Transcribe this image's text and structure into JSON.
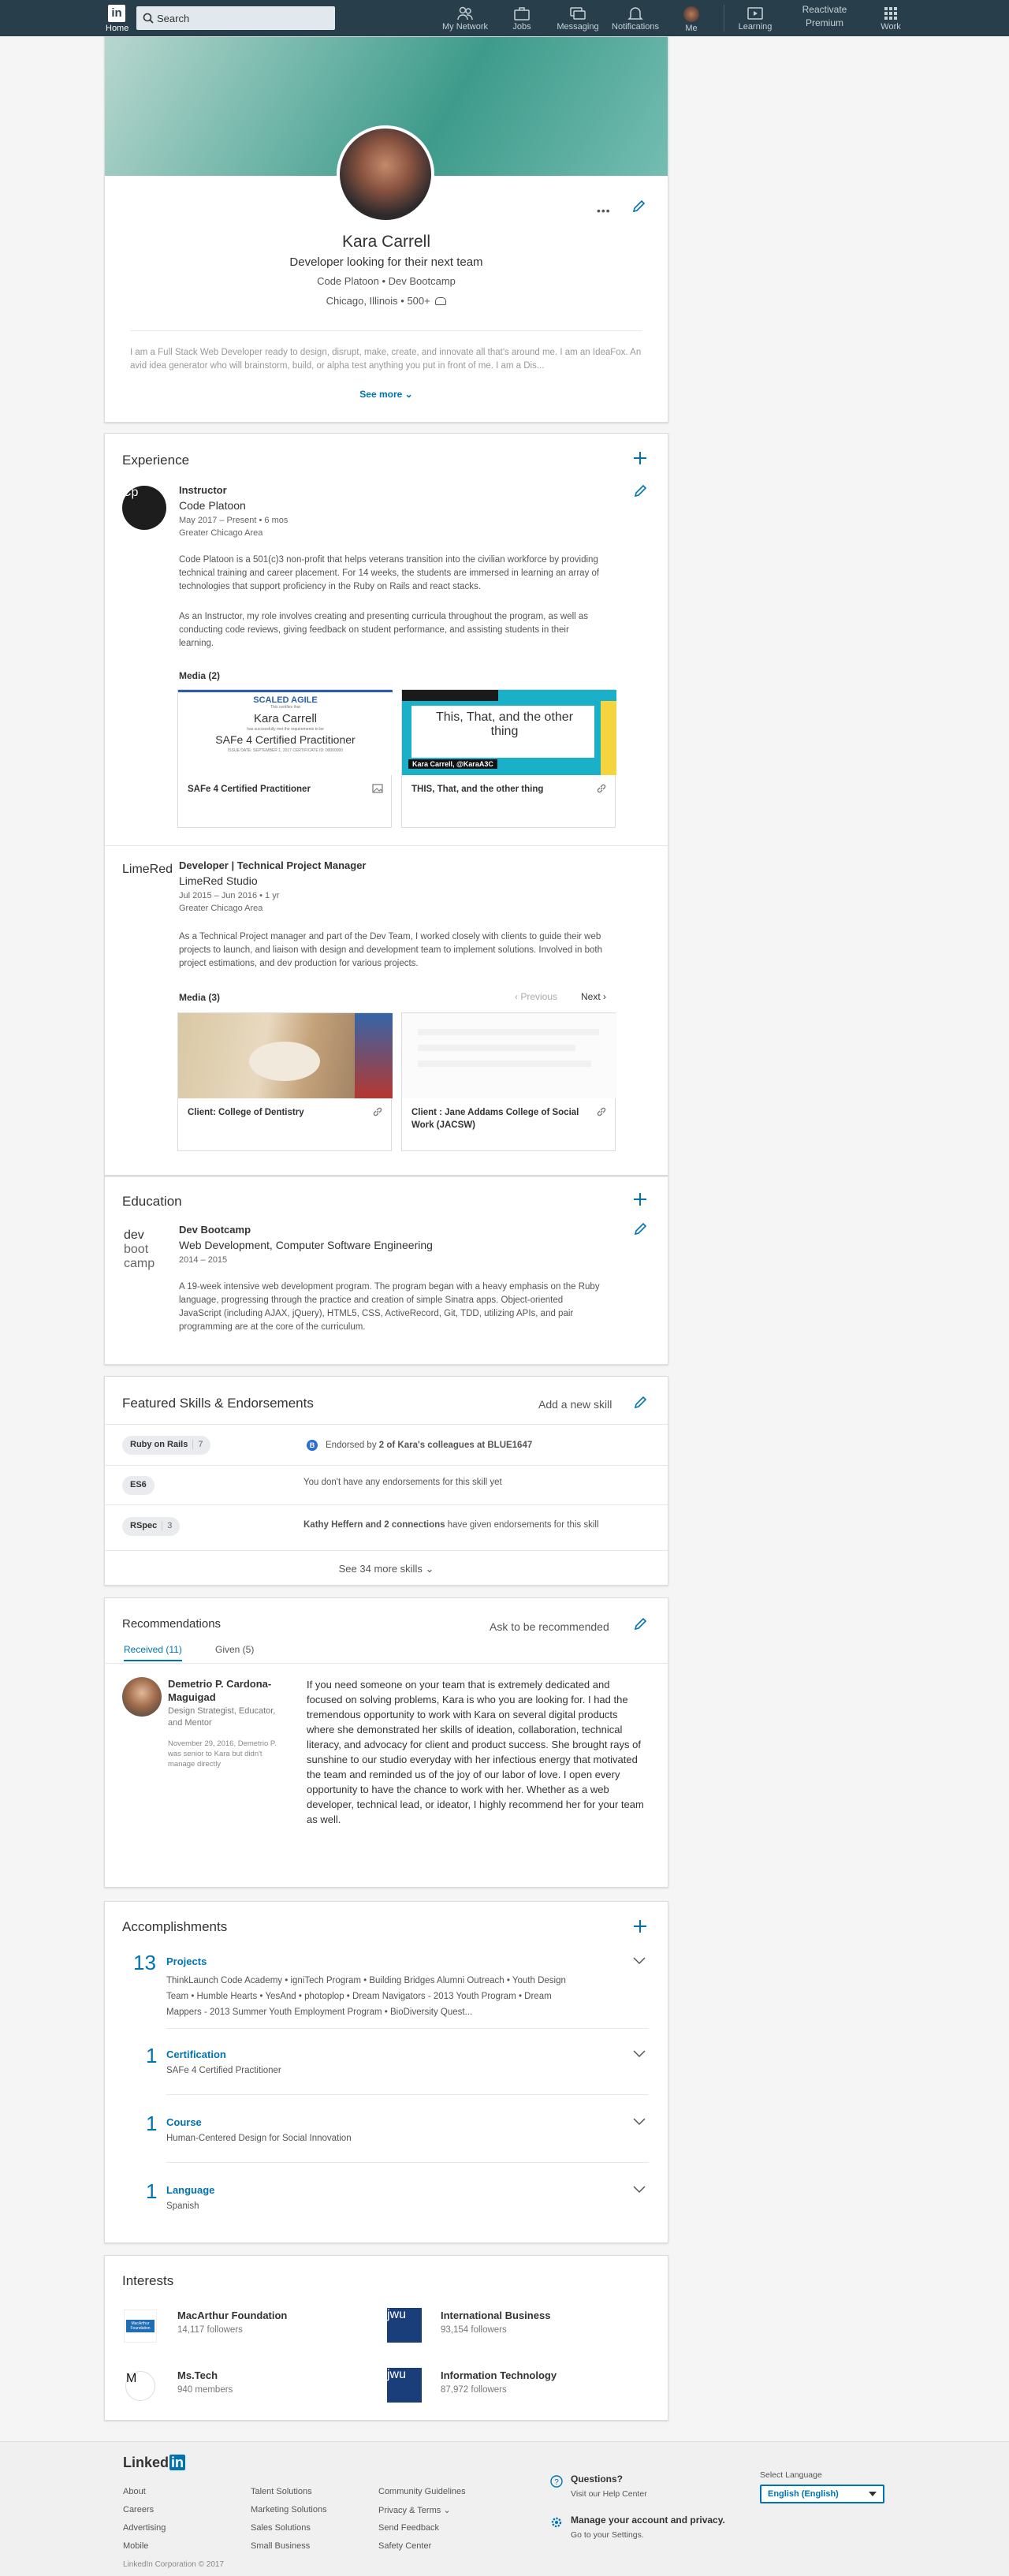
{
  "nav": {
    "home": "Home",
    "search_placeholder": "Search",
    "items": [
      "My Network",
      "Jobs",
      "Messaging",
      "Notifications",
      "Me"
    ],
    "learning": "Learning",
    "reactivate": "Reactivate Premium",
    "work": "Work"
  },
  "profile": {
    "name": "Kara Carrell",
    "headline": "Developer looking for their next team",
    "companies": "Code Platoon • Dev Bootcamp",
    "location": "Chicago, Illinois • 500+",
    "summary": "I am a Full Stack Web Developer ready to design, disrupt, make, create, and innovate all that's around me. I am an IdeaFox. An avid idea generator who will brainstorm, build, or alpha test anything you put in front of me. I am a Dis...",
    "see_more": "See more",
    "more_dots": "•••"
  },
  "experience": {
    "title": "Experience",
    "jobs": [
      {
        "role": "Instructor",
        "company": "Code Platoon",
        "dates": "May 2017 – Present  •  6 mos",
        "location": "Greater Chicago Area",
        "desc1": "Code Platoon is a 501(c)3 non-profit that helps veterans transition into the civilian workforce by providing technical training and career placement. For 14 weeks, the students are immersed in learning an array of technologies that support proficiency in the Ruby on Rails and react stacks.",
        "desc2": "As an Instructor, my role involves creating and presenting curricula throughout the program, as well as conducting code reviews, giving feedback on student performance, and assisting students in their learning.",
        "media_label": "Media (2)",
        "media": [
          {
            "caption": "SAFe 4 Certified Practitioner",
            "cert_top": "SCALED AGILE",
            "cert_sub": "This certifies that",
            "cert_name": "Kara Carrell",
            "cert_mid": "has successfully met the requirements to be",
            "cert_title": "SAFe 4 Certified Practitioner",
            "cert_foot": "ISSUE DATE: SEPTEMBER 1, 2017     CERTIFICATE ID: 00000000"
          },
          {
            "caption": "THIS, That, and the other thing",
            "slide_title": "This, That, and the other thing",
            "slide_tag": "Kara Carrell, @KaraA3C"
          }
        ]
      },
      {
        "logo_text": "LimeRed",
        "role": "Developer | Technical Project Manager",
        "company": "LimeRed Studio",
        "dates": "Jul 2015 – Jun 2016  •  1 yr",
        "location": "Greater Chicago Area",
        "desc1": "As a Technical Project manager and part of the Dev Team, I worked closely with clients to guide their web projects to launch, and liaison with design and development team to implement solutions. Involved in both project estimations, and dev production for various projects.",
        "media_label": "Media (3)",
        "prev": "Previous",
        "next": "Next",
        "media": [
          {
            "caption": "Client: College of Dentistry"
          },
          {
            "caption": "Client : Jane Addams College of Social Work (JACSW)"
          }
        ]
      }
    ]
  },
  "education": {
    "title": "Education",
    "logo_lines": [
      "dev",
      "boot",
      "camp"
    ],
    "school": "Dev Bootcamp",
    "degree": "Web Development, Computer Software Engineering",
    "dates": "2014 – 2015",
    "desc": "A 19-week intensive web development program. The program began with a heavy emphasis on the Ruby language, progressing through the practice and creation of simple Sinatra apps. Object-oriented JavaScript (including AJAX, jQuery), HTML5, CSS, ActiveRecord, Git, TDD, utilizing APIs, and pair programming are at the core of the curriculum."
  },
  "skills": {
    "title": "Featured Skills & Endorsements",
    "add": "Add a new skill",
    "rows": [
      {
        "name": "Ruby on Rails",
        "count": "7",
        "badge": "B",
        "note_pre": "Endorsed by ",
        "note_bold": "2 of Kara's colleagues at BLUE1647",
        "note_post": ""
      },
      {
        "name": "ES6",
        "count": "",
        "badge": "",
        "note_pre": "You don't have any endorsements for this skill yet",
        "note_bold": "",
        "note_post": ""
      },
      {
        "name": "RSpec",
        "count": "3",
        "badge": "",
        "note_pre": "",
        "note_bold": "Kathy Heffern and 2 connections",
        "note_post": " have given endorsements for this skill"
      }
    ],
    "see_more": "See 34 more skills"
  },
  "recommendations": {
    "title": "Recommendations",
    "ask": "Ask to be recommended",
    "tab_received": "Received (11)",
    "tab_given": "Given (5)",
    "name": "Demetrio P. Cardona-Maguigad",
    "role": "Design Strategist, Educator, and Mentor",
    "meta": "November 29, 2016, Demetrio P. was senior to Kara but didn't manage directly",
    "text": "If you need someone on your team that is extremely dedicated and focused on solving problems, Kara is who you are looking for. I had the tremendous opportunity to work with Kara on several digital products where she demonstrated her skills of ideation, collaboration, technical literacy, and advocacy for client and product success. She brought rays of sunshine to our studio everyday with her infectious energy that motivated the team and reminded us of the joy of our labor of love. I open every opportunity to have the chance to work with her. Whether as a web developer, technical lead, or ideator, I highly recommend her for your team as well."
  },
  "accomplishments": {
    "title": "Accomplishments",
    "items": [
      {
        "count": "13",
        "label": "Projects",
        "detail": "ThinkLaunch Code Academy  •  igniTech Program  •  Building Bridges Alumni Outreach  •  Youth Design Team  •  Humble Hearts  •  YesAnd  •  photoplop  •  Dream Navigators - 2013 Youth Program  •  Dream Mappers - 2013 Summer Youth Employment Program  •  BioDiversity Quest..."
      },
      {
        "count": "1",
        "label": "Certification",
        "detail": "SAFe 4 Certified Practitioner"
      },
      {
        "count": "1",
        "label": "Course",
        "detail": "Human-Centered Design for Social Innovation"
      },
      {
        "count": "1",
        "label": "Language",
        "detail": "Spanish"
      }
    ]
  },
  "interests": {
    "title": "Interests",
    "items": [
      {
        "name": "MacArthur Foundation",
        "followers": "14,117 followers",
        "logo": "MacArthur Foundation"
      },
      {
        "name": "International Business",
        "followers": "93,154 followers",
        "logo": "jwu"
      },
      {
        "name": "Ms.Tech",
        "followers": "940 members",
        "logo": "M"
      },
      {
        "name": "Information Technology",
        "followers": "87,972 followers",
        "logo": "jwu"
      }
    ]
  },
  "footer": {
    "logo": "Linked",
    "logo_in": "in",
    "col1": [
      "About",
      "Careers",
      "Advertising",
      "Mobile"
    ],
    "col2": [
      "Talent Solutions",
      "Marketing Solutions",
      "Sales Solutions",
      "Small Business"
    ],
    "col3": [
      "Community Guidelines",
      "Privacy & Terms",
      "Send Feedback",
      "Safety Center"
    ],
    "questions": "Questions?",
    "help": "Visit our Help Center",
    "manage": "Manage your account and privacy.",
    "settings": "Go to your Settings.",
    "select_language": "Select Language",
    "language": "English (English)",
    "copyright": "LinkedIn Corporation © 2017"
  },
  "colors": {
    "accent": "#0073b1",
    "nav": "#283e4a"
  }
}
